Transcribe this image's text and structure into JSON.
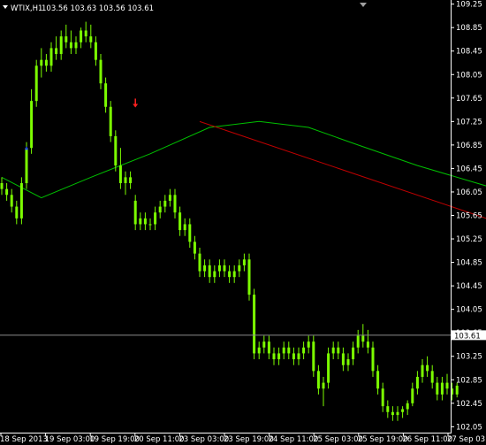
{
  "header": {
    "symbol": "WTIX,H1",
    "ohlc": "103.56 103.63 103.56 103.61"
  },
  "colors": {
    "background": "#000000",
    "candle": "#7CFC00",
    "moving_average": "#00C000",
    "trend_line": "#C00000",
    "axis": "#ffffff",
    "price_line": "#8a8a8a",
    "arrow_down": "#ff2020",
    "arrow_up": "#2040ff"
  },
  "chart_data": {
    "type": "candlestick",
    "symbol": "WTIX",
    "timeframe": "H1",
    "current_price": 103.61,
    "current_price_label": "103.61",
    "ylim": [
      101.95,
      109.32
    ],
    "y_ticks": [
      "109.25",
      "108.85",
      "108.45",
      "108.05",
      "107.65",
      "107.25",
      "106.85",
      "106.45",
      "106.05",
      "105.65",
      "105.25",
      "104.85",
      "104.45",
      "104.05",
      "103.65",
      "103.25",
      "102.85",
      "102.45",
      "102.05"
    ],
    "x_ticks": [
      "18 Sep 2013",
      "19 Sep 03:00",
      "19 Sep 19:00",
      "20 Sep 11:00",
      "23 Sep 03:00",
      "23 Sep 19:00",
      "24 Sep 11:00",
      "25 Sep 03:00",
      "25 Sep 19:00",
      "26 Sep 11:00",
      "27 Sep 03:00"
    ],
    "candles": [
      [
        106.2,
        106.3,
        106.0,
        106.1
      ],
      [
        106.1,
        106.2,
        105.9,
        106.0
      ],
      [
        106.0,
        106.1,
        105.7,
        105.8
      ],
      [
        105.8,
        105.9,
        105.5,
        105.6
      ],
      [
        105.6,
        106.3,
        105.5,
        106.2
      ],
      [
        106.2,
        106.9,
        106.1,
        106.8
      ],
      [
        106.8,
        107.8,
        106.7,
        107.6
      ],
      [
        107.6,
        108.3,
        107.5,
        108.2
      ],
      [
        108.2,
        108.5,
        108.0,
        108.3
      ],
      [
        108.3,
        108.4,
        108.1,
        108.2
      ],
      [
        108.2,
        108.6,
        108.1,
        108.5
      ],
      [
        108.5,
        108.7,
        108.3,
        108.4
      ],
      [
        108.4,
        108.8,
        108.3,
        108.7
      ],
      [
        108.7,
        108.9,
        108.5,
        108.6
      ],
      [
        108.6,
        108.8,
        108.4,
        108.5
      ],
      [
        108.5,
        108.7,
        108.4,
        108.6
      ],
      [
        108.6,
        108.85,
        108.5,
        108.8
      ],
      [
        108.8,
        108.95,
        108.6,
        108.7
      ],
      [
        108.7,
        108.9,
        108.5,
        108.6
      ],
      [
        108.6,
        108.7,
        108.2,
        108.3
      ],
      [
        108.3,
        108.4,
        107.8,
        107.9
      ],
      [
        107.9,
        108.0,
        107.4,
        107.5
      ],
      [
        107.5,
        107.6,
        106.9,
        107.0
      ],
      [
        107.0,
        107.1,
        106.4,
        106.5
      ],
      [
        106.5,
        106.8,
        106.1,
        106.2
      ],
      [
        106.2,
        106.4,
        106.0,
        106.3
      ],
      [
        106.3,
        106.4,
        106.1,
        106.2
      ],
      [
        105.9,
        106.0,
        105.4,
        105.5
      ],
      [
        105.5,
        105.7,
        105.4,
        105.6
      ],
      [
        105.6,
        105.7,
        105.4,
        105.5
      ],
      [
        105.5,
        105.6,
        105.4,
        105.5
      ],
      [
        105.5,
        105.8,
        105.4,
        105.7
      ],
      [
        105.7,
        105.9,
        105.6,
        105.8
      ],
      [
        105.8,
        106.0,
        105.7,
        105.9
      ],
      [
        105.9,
        106.1,
        105.8,
        106.0
      ],
      [
        106.0,
        106.1,
        105.6,
        105.7
      ],
      [
        105.7,
        105.8,
        105.3,
        105.4
      ],
      [
        105.4,
        105.6,
        105.3,
        105.5
      ],
      [
        105.5,
        105.6,
        105.1,
        105.2
      ],
      [
        105.2,
        105.3,
        104.9,
        105.0
      ],
      [
        105.0,
        105.1,
        104.6,
        104.7
      ],
      [
        104.7,
        104.9,
        104.6,
        104.8
      ],
      [
        104.8,
        104.9,
        104.5,
        104.6
      ],
      [
        104.6,
        104.8,
        104.5,
        104.7
      ],
      [
        104.7,
        104.9,
        104.6,
        104.8
      ],
      [
        104.8,
        104.9,
        104.6,
        104.7
      ],
      [
        104.7,
        104.8,
        104.5,
        104.6
      ],
      [
        104.6,
        104.8,
        104.5,
        104.7
      ],
      [
        104.7,
        104.9,
        104.6,
        104.8
      ],
      [
        104.8,
        105.0,
        104.7,
        104.9
      ],
      [
        104.9,
        105.0,
        104.2,
        104.3
      ],
      [
        104.3,
        104.4,
        103.2,
        103.3
      ],
      [
        103.3,
        103.5,
        103.2,
        103.4
      ],
      [
        103.4,
        103.6,
        103.3,
        103.5
      ],
      [
        103.5,
        103.6,
        103.2,
        103.3
      ],
      [
        103.3,
        103.4,
        103.1,
        103.2
      ],
      [
        103.2,
        103.4,
        103.1,
        103.3
      ],
      [
        103.3,
        103.5,
        103.2,
        103.4
      ],
      [
        103.4,
        103.5,
        103.2,
        103.3
      ],
      [
        103.3,
        103.4,
        103.1,
        103.2
      ],
      [
        103.2,
        103.4,
        103.1,
        103.3
      ],
      [
        103.3,
        103.5,
        103.2,
        103.4
      ],
      [
        103.4,
        103.6,
        103.3,
        103.5
      ],
      [
        103.5,
        103.6,
        102.9,
        103.0
      ],
      [
        103.0,
        103.1,
        102.6,
        102.7
      ],
      [
        102.7,
        102.9,
        102.4,
        102.8
      ],
      [
        102.8,
        103.4,
        102.7,
        103.3
      ],
      [
        103.3,
        103.5,
        103.2,
        103.4
      ],
      [
        103.4,
        103.5,
        103.2,
        103.3
      ],
      [
        103.3,
        103.4,
        103.0,
        103.1
      ],
      [
        103.1,
        103.3,
        103.0,
        103.2
      ],
      [
        103.2,
        103.5,
        103.1,
        103.4
      ],
      [
        103.4,
        103.7,
        103.3,
        103.6
      ],
      [
        103.6,
        103.8,
        103.4,
        103.5
      ],
      [
        103.5,
        103.7,
        103.3,
        103.4
      ],
      [
        103.4,
        103.5,
        102.9,
        103.0
      ],
      [
        103.0,
        103.1,
        102.6,
        102.7
      ],
      [
        102.7,
        102.8,
        102.3,
        102.4
      ],
      [
        102.4,
        102.5,
        102.2,
        102.3
      ],
      [
        102.3,
        102.4,
        102.15,
        102.25
      ],
      [
        102.25,
        102.4,
        102.15,
        102.3
      ],
      [
        102.3,
        102.4,
        102.2,
        102.35
      ],
      [
        102.35,
        102.5,
        102.25,
        102.45
      ],
      [
        102.45,
        102.8,
        102.4,
        102.7
      ],
      [
        102.7,
        103.0,
        102.6,
        102.9
      ],
      [
        102.9,
        103.2,
        102.8,
        103.1
      ],
      [
        103.1,
        103.25,
        102.9,
        103.0
      ],
      [
        103.0,
        103.1,
        102.7,
        102.8
      ],
      [
        102.8,
        102.9,
        102.5,
        102.6
      ],
      [
        102.6,
        102.9,
        102.5,
        102.8
      ],
      [
        102.8,
        102.95,
        102.6,
        102.7
      ],
      [
        102.7,
        102.8,
        102.5,
        102.6
      ],
      [
        102.6,
        102.8,
        102.55,
        102.75
      ]
    ],
    "moving_average": [
      [
        0,
        106.3
      ],
      [
        8,
        105.95
      ],
      [
        18,
        106.3
      ],
      [
        30,
        106.7
      ],
      [
        42,
        107.15
      ],
      [
        52,
        107.25
      ],
      [
        62,
        107.15
      ],
      [
        72,
        106.85
      ],
      [
        84,
        106.5
      ],
      [
        96,
        106.2
      ],
      [
        106,
        105.95
      ],
      [
        116,
        105.7
      ],
      [
        126,
        105.2
      ],
      [
        136,
        104.7
      ],
      [
        146,
        104.3
      ],
      [
        156,
        104.0
      ],
      [
        166,
        103.75
      ],
      [
        176,
        103.5
      ],
      [
        186,
        103.3
      ],
      [
        196,
        103.15
      ],
      [
        206,
        103.0
      ],
      [
        216,
        102.85
      ],
      [
        226,
        102.75
      ],
      [
        236,
        102.6
      ]
    ],
    "trend_line": {
      "start": [
        40,
        107.25
      ],
      "end": [
        226,
        101.95
      ]
    },
    "markers": [
      {
        "type": "arrow_down",
        "candle": 27,
        "price": 107.55
      },
      {
        "type": "arrow_up",
        "candle": 5,
        "price": 106.8
      }
    ]
  }
}
